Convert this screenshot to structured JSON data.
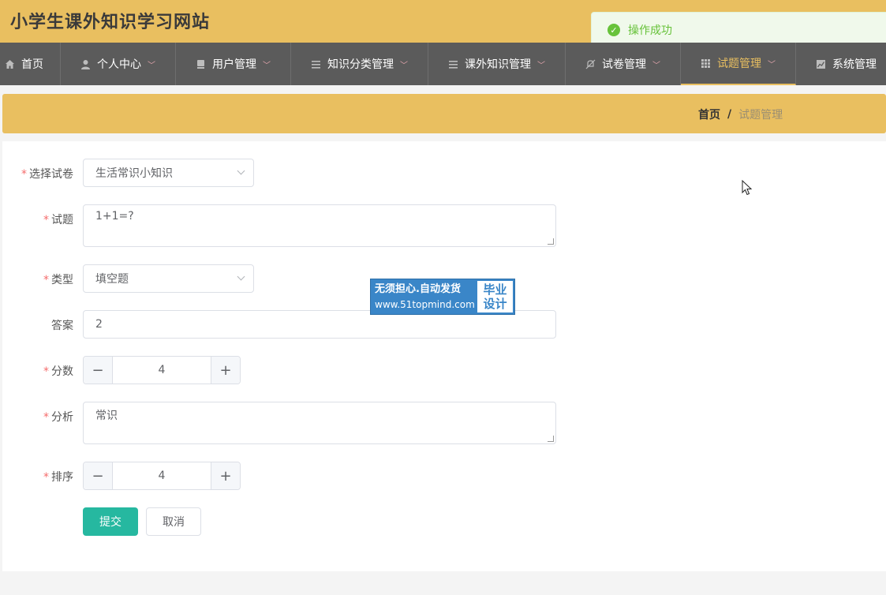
{
  "header": {
    "title": "小学生课外知识学习网站"
  },
  "toast": {
    "message": "操作成功"
  },
  "nav": {
    "items": [
      {
        "label": "首页",
        "icon": "home-icon"
      },
      {
        "label": "个人中心",
        "icon": "user-icon"
      },
      {
        "label": "用户管理",
        "icon": "book-icon"
      },
      {
        "label": "知识分类管理",
        "icon": "list-icon"
      },
      {
        "label": "课外知识管理",
        "icon": "list-icon"
      },
      {
        "label": "试卷管理",
        "icon": "no-bell-icon"
      },
      {
        "label": "试题管理",
        "icon": "grid-icon",
        "active": true
      },
      {
        "label": "系统管理",
        "icon": "chart-icon"
      }
    ]
  },
  "breadcrumb": {
    "home": "首页",
    "separator": "/",
    "current": "试题管理"
  },
  "form": {
    "paper_label": "选择试卷",
    "paper_value": "生活常识小知识",
    "question_label": "试题",
    "question_value": "1+1=?",
    "type_label": "类型",
    "type_value": "填空题",
    "answer_label": "答案",
    "answer_value": "2",
    "score_label": "分数",
    "score_value": "4",
    "analysis_label": "分析",
    "analysis_value": "常识",
    "order_label": "排序",
    "order_value": "4",
    "required_mark": "*",
    "submit_label": "提交",
    "cancel_label": "取消"
  },
  "watermark": {
    "line1": "无须担心.自动发货",
    "line2": "www.51topmind.com",
    "badge_top": "毕业",
    "badge_bottom": "设计"
  },
  "colors": {
    "accent": "#e9bf60",
    "nav_bg": "#5b5b5b",
    "submit": "#26b8a0",
    "success": "#67c23a",
    "required": "#f56c6c"
  }
}
